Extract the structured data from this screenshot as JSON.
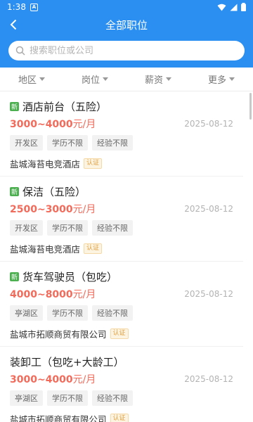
{
  "status": {
    "time": "1:38",
    "app_icon": "A"
  },
  "header": {
    "title": "全部职位",
    "back_icon": "chevron-left-icon"
  },
  "search": {
    "placeholder": "搜索职位或公司",
    "value": ""
  },
  "filters": [
    {
      "label": "地区"
    },
    {
      "label": "岗位"
    },
    {
      "label": "薪资"
    },
    {
      "label": "更多"
    }
  ],
  "colors": {
    "primary": "#2b8ff2",
    "salary": "#f26a5a",
    "new_badge": "#4caf50",
    "verify": "#e0a040"
  },
  "jobs": [
    {
      "is_new": true,
      "new_label": "新",
      "title": "酒店前台（五险）",
      "salary": "3000~4000",
      "unit": "元/月",
      "date": "2025-08-12",
      "tags": [
        "开发区",
        "学历不限",
        "经验不限"
      ],
      "company": "盐城海苔电竞酒店",
      "verified": "认证"
    },
    {
      "is_new": true,
      "new_label": "新",
      "title": "保洁（五险）",
      "salary": "2500~3000",
      "unit": "元/月",
      "date": "2025-08-12",
      "tags": [
        "开发区",
        "学历不限",
        "经验不限"
      ],
      "company": "盐城海苔电竞酒店",
      "verified": "认证"
    },
    {
      "is_new": true,
      "new_label": "新",
      "title": "货车驾驶员（包吃）",
      "salary": "4000~8000",
      "unit": "元/月",
      "date": "2025-08-12",
      "tags": [
        "亭湖区",
        "学历不限",
        "经验不限"
      ],
      "company": "盐城市拓顺商贸有限公司",
      "verified": "认证"
    },
    {
      "is_new": false,
      "new_label": "",
      "title": "装卸工（包吃+大龄工）",
      "salary": "3000~4000",
      "unit": "元/月",
      "date": "2025-08-12",
      "tags": [
        "亭湖区",
        "学历不限",
        "经验不限"
      ],
      "company": "盐城市拓顺商贸有限公司",
      "verified": "认证"
    }
  ]
}
